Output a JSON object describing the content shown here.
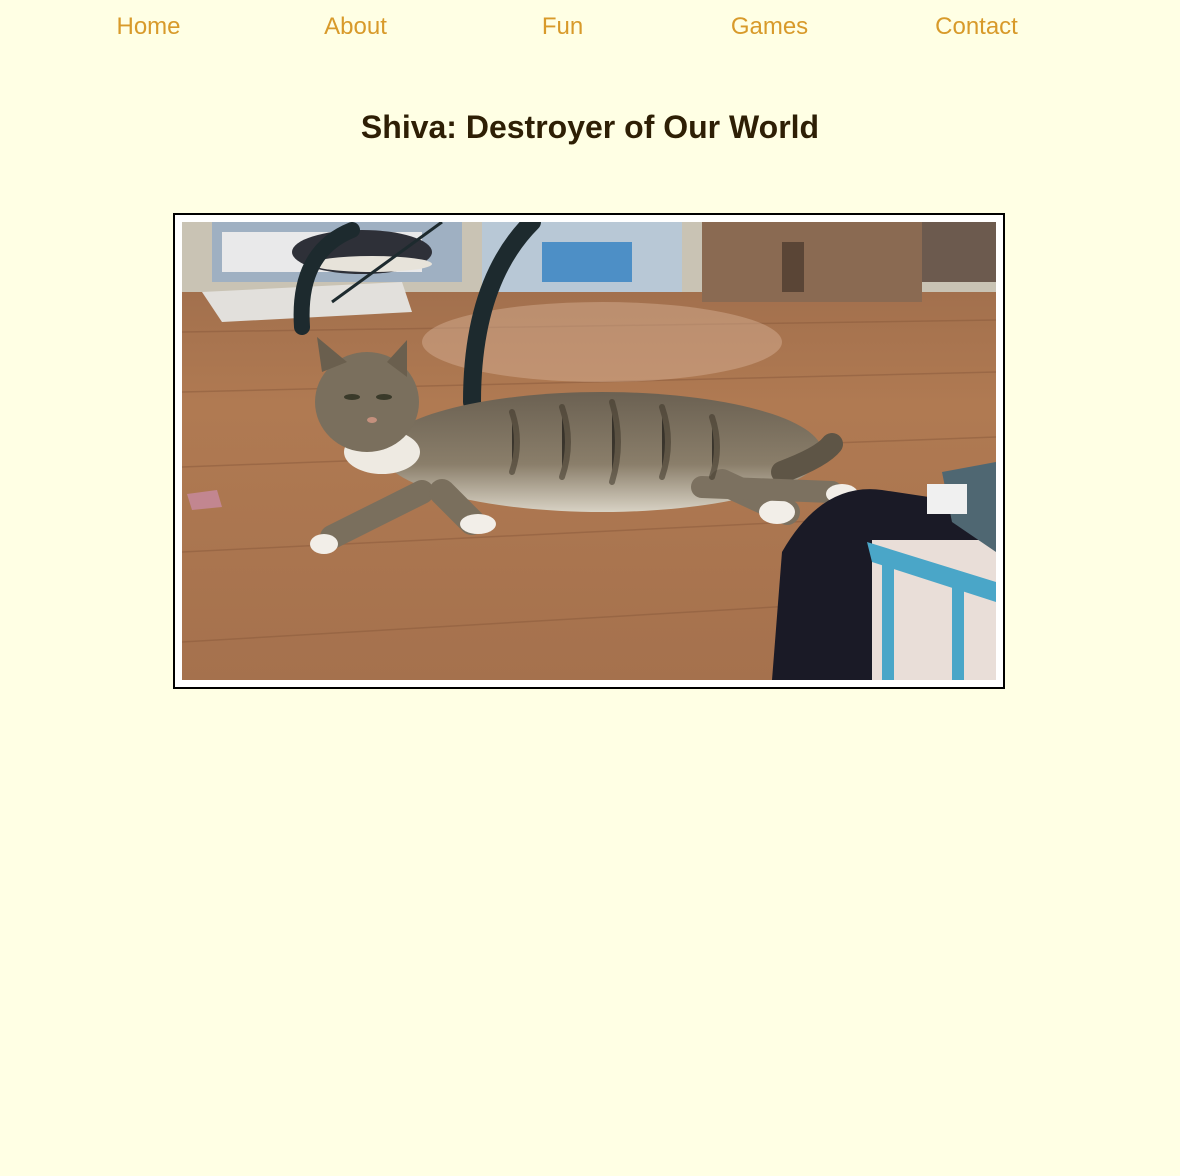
{
  "nav": {
    "items": [
      {
        "label": "Home"
      },
      {
        "label": "About"
      },
      {
        "label": "Fun"
      },
      {
        "label": "Games"
      },
      {
        "label": "Contact"
      }
    ]
  },
  "page": {
    "title": "Shiva: Destroyer of Our World"
  },
  "photo": {
    "subject": "cat-photo"
  },
  "colors": {
    "background": "#ffffe4",
    "nav_link": "#d89a2a",
    "title": "#2e1f05",
    "frame_border": "#000000"
  }
}
